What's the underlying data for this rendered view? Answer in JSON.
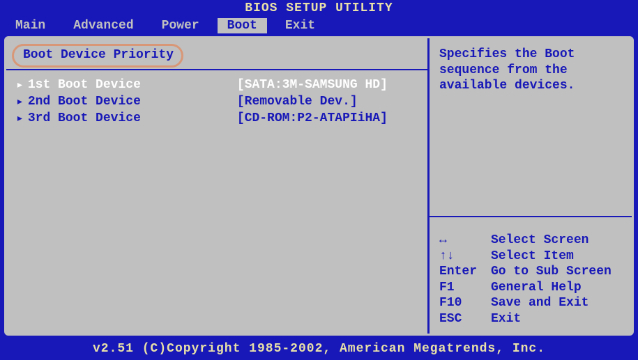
{
  "title": "BIOS SETUP UTILITY",
  "menu": {
    "items": [
      "Main",
      "Advanced",
      "Power",
      "Boot",
      "Exit"
    ],
    "active_index": 3
  },
  "section": {
    "title": "Boot Device Priority"
  },
  "boot": [
    {
      "label": "1st Boot Device",
      "value": "[SATA:3M-SAMSUNG HD]",
      "selected": true
    },
    {
      "label": "2nd Boot Device",
      "value": "[Removable Dev.]",
      "selected": false
    },
    {
      "label": "3rd Boot Device",
      "value": "[CD-ROM:P2-ATAPIiHA]",
      "selected": false
    }
  ],
  "help": {
    "text": "Specifies the Boot sequence from the available devices."
  },
  "keys": [
    {
      "key": "↔",
      "label": "Select Screen"
    },
    {
      "key": "↑↓",
      "label": "Select Item"
    },
    {
      "key": "Enter",
      "label": "Go to Sub Screen"
    },
    {
      "key": "F1",
      "label": "General Help"
    },
    {
      "key": "F10",
      "label": "Save and Exit"
    },
    {
      "key": "ESC",
      "label": "Exit"
    }
  ],
  "footer": "v2.51 (C)Copyright 1985-2002, American Megatrends, Inc.",
  "arrow_glyph": "▸"
}
